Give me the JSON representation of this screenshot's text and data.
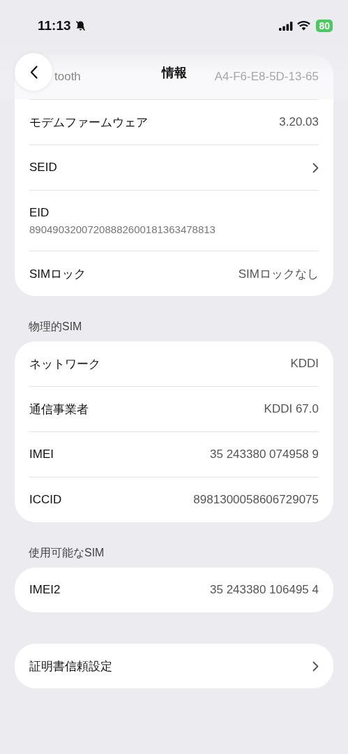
{
  "status_bar": {
    "time": "11:13",
    "battery": "80"
  },
  "nav": {
    "title": "情報"
  },
  "sections": [
    {
      "rows": [
        {
          "kind": "partial",
          "label": "tooth",
          "value": "A4-F6-E8-5D-13-65"
        },
        {
          "kind": "value",
          "label": "モデムファームウェア",
          "value": "3.20.03"
        },
        {
          "kind": "link",
          "label": "SEID"
        },
        {
          "kind": "stacked",
          "label": "EID",
          "value": "89049032007208882600181363478813"
        },
        {
          "kind": "value",
          "label": "SIMロック",
          "value": "SIMロックなし"
        }
      ]
    },
    {
      "header": "物理的SIM",
      "rows": [
        {
          "kind": "value",
          "label": "ネットワーク",
          "value": "KDDI"
        },
        {
          "kind": "value",
          "label": "通信事業者",
          "value": "KDDI 67.0"
        },
        {
          "kind": "value",
          "label": "IMEI",
          "value": "35 243380 074958 9"
        },
        {
          "kind": "value",
          "label": "ICCID",
          "value": "8981300058606729075"
        }
      ]
    },
    {
      "header": "使用可能なSIM",
      "rows": [
        {
          "kind": "value",
          "label": "IMEI2",
          "value": "35 243380 106495 4"
        }
      ]
    },
    {
      "rows": [
        {
          "kind": "link",
          "label": "証明書信頼設定"
        }
      ]
    }
  ]
}
